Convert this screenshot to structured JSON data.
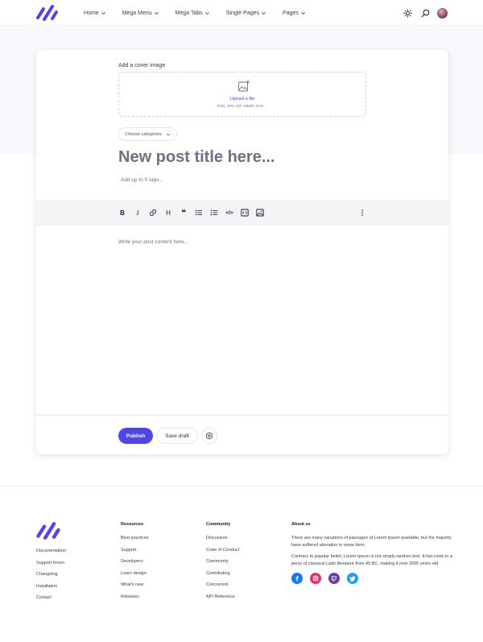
{
  "header": {
    "nav": [
      {
        "label": "Home"
      },
      {
        "label": "Mega Menu"
      },
      {
        "label": "Mega Tabs"
      },
      {
        "label": "Single Pages"
      },
      {
        "label": "Pages"
      }
    ],
    "icons": [
      "sun-icon",
      "search-icon",
      "avatar"
    ]
  },
  "editor": {
    "cover_label": "Add a cover image",
    "upload_link": "Upload a file",
    "upload_hint": "PNG, JPG, GIF, WEBP, SVG ...",
    "categories_button": "Choose categories",
    "title_placeholder": "New post title here...",
    "tags_placeholder": "Add up to 5 tags...",
    "toolbar": [
      "bold-icon",
      "italic-icon",
      "link-icon",
      "heading-icon",
      "quote-icon",
      "bullet-list-icon",
      "numbered-list-icon",
      "code-icon",
      "code-block-icon",
      "image-icon",
      "more-icon"
    ],
    "toolbar_glyphs": {
      "bold": "B",
      "italic": "I",
      "heading": "H",
      "quote": "❝",
      "code": "</>"
    },
    "content_placeholder": "Write your post content here...",
    "publish_button": "Publish",
    "save_draft_button": "Save draft"
  },
  "footer": {
    "links": [
      "Documentation",
      "Support forum",
      "Changelog",
      "Installation",
      "Contact"
    ],
    "resources": {
      "heading": "Resources",
      "items": [
        "Best practices",
        "Support",
        "Developers",
        "Learn design",
        "What's new",
        "Releases"
      ]
    },
    "community": {
      "heading": "Community",
      "items": [
        "Discussion",
        "Code of Conduct",
        "Community",
        "Contributing",
        "Concurrent",
        "API Reference"
      ]
    },
    "about": {
      "heading": "About us",
      "p1": "There are many variations of passages of Lorem Ipsum available, but the majority have suffered alteration in some form.",
      "p2": "Contrary to popular belief, Lorem Ipsum is not simply random text. It has roots in a piece of classical Latin literature from 45 BC, making it over 2000 years old."
    },
    "socials": [
      {
        "name": "facebook-icon",
        "color": "#1877f2"
      },
      {
        "name": "instagram-icon",
        "color": "#e1306c"
      },
      {
        "name": "twitch-icon",
        "color": "#6441a5"
      },
      {
        "name": "twitter-icon",
        "color": "#1da1f2"
      }
    ]
  },
  "colors": {
    "accent": "#4f46e5",
    "band": "#f8f9fc",
    "toolbar": "#f3f4f6"
  }
}
